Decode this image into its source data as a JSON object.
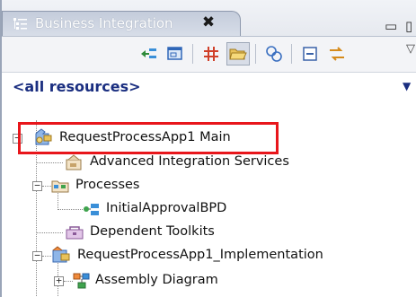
{
  "view": {
    "title": "Business Integration",
    "close_glyph": "✖",
    "minmax_glyph": "▭ ▯",
    "icon": "business-integration-icon"
  },
  "toolbar": {
    "buttons": [
      "link-with-editor-icon",
      "new-artifact-icon",
      "show-grid-icon",
      "open-folder-icon",
      "refresh-icon",
      "collapse-all-icon",
      "sync-icon"
    ],
    "menu_glyph": "▽"
  },
  "filter": {
    "label": "<all resources>",
    "arrow": "▼"
  },
  "tree": {
    "root": {
      "label": "RequestProcessApp1 Main",
      "toggle": "−",
      "icon": "process-app-icon"
    },
    "items": [
      {
        "label": "Advanced Integration Services",
        "icon": "integration-services-icon"
      },
      {
        "label": "Processes",
        "toggle": "−",
        "icon": "processes-folder-icon"
      },
      {
        "label": "InitialApprovalBPD",
        "icon": "bpd-icon"
      },
      {
        "label": "Dependent Toolkits",
        "icon": "toolkits-icon"
      },
      {
        "label": "RequestProcessApp1_Implementation",
        "toggle": "−",
        "icon": "implementation-module-icon"
      },
      {
        "label": "Assembly Diagram",
        "toggle": "+",
        "icon": "assembly-diagram-icon"
      }
    ]
  },
  "colors": {
    "highlight": "#e8161b",
    "filter_text": "#1a2e80",
    "tab_bg": "#c4ccdb"
  }
}
